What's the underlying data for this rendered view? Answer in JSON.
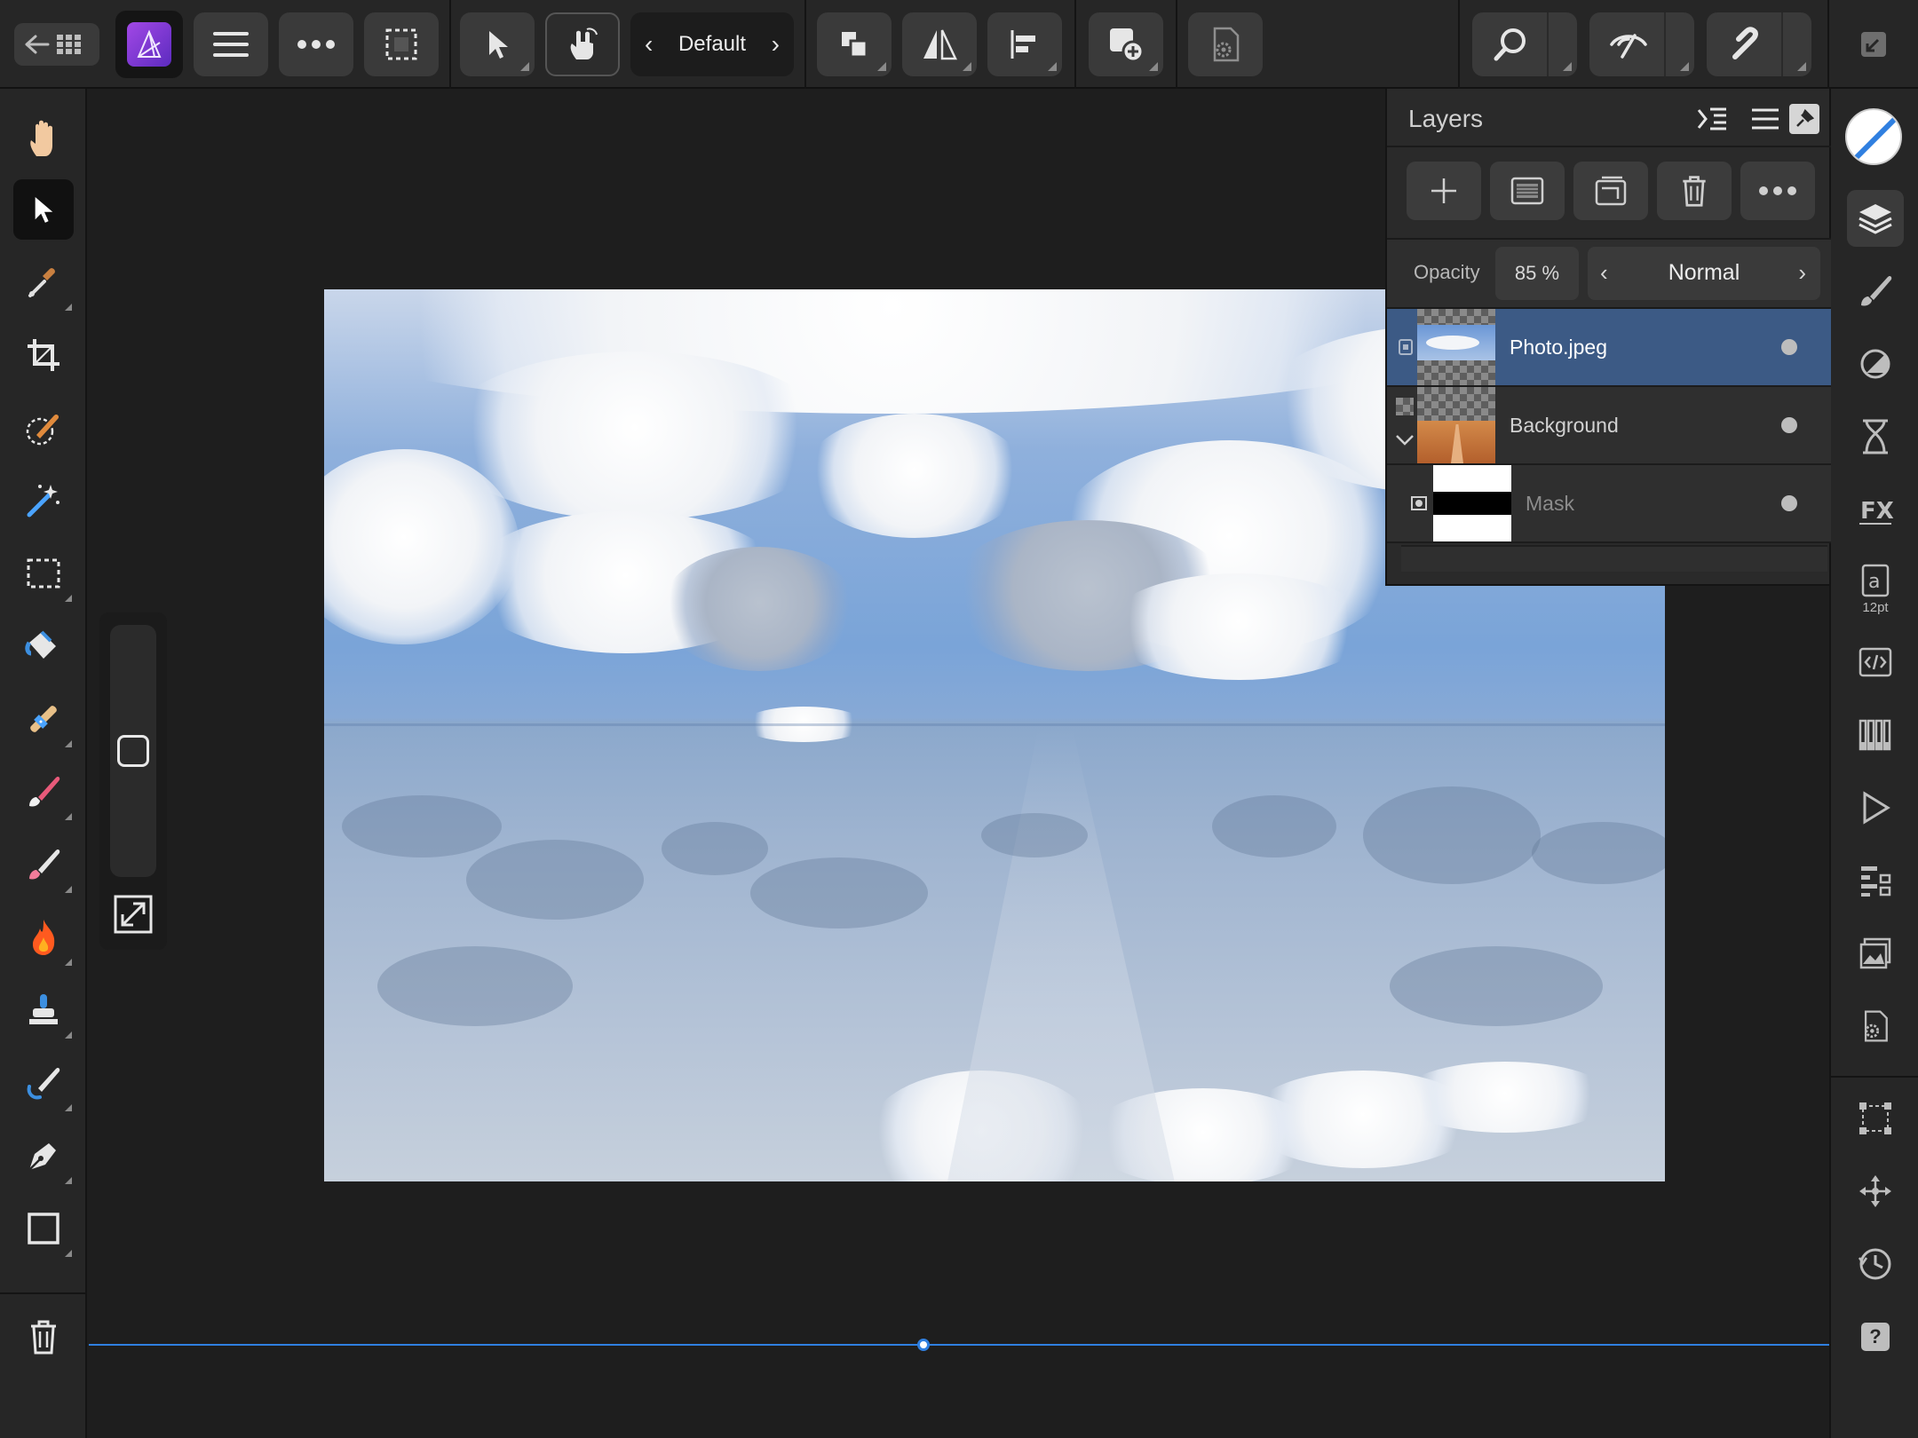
{
  "toolbar": {
    "persona_preset": "Default",
    "colors": {
      "accent_persona": "#7a3fd1",
      "background": "#262626",
      "button": "#3a3a3a"
    }
  },
  "left_tools": [
    {
      "name": "view-tool",
      "icon": "hand-icon"
    },
    {
      "name": "move-tool",
      "icon": "arrow-pointer-icon",
      "active": true
    },
    {
      "name": "color-picker-tool",
      "icon": "eyedropper-icon"
    },
    {
      "name": "crop-tool",
      "icon": "crop-icon"
    },
    {
      "name": "selection-brush-tool",
      "icon": "selection-brush-icon"
    },
    {
      "name": "flood-select-tool",
      "icon": "magic-wand-icon"
    },
    {
      "name": "marquee-tool",
      "icon": "rectangle-marquee-icon"
    },
    {
      "name": "flood-fill-tool",
      "icon": "paint-bucket-icon"
    },
    {
      "name": "inpainting-tool",
      "icon": "bandage-icon"
    },
    {
      "name": "paint-brush-tool",
      "icon": "brush-icon"
    },
    {
      "name": "erase-brush-tool",
      "icon": "eraser-icon"
    },
    {
      "name": "burn-tool",
      "icon": "flame-icon"
    },
    {
      "name": "clone-tool",
      "icon": "stamp-icon"
    },
    {
      "name": "smudge-tool",
      "icon": "smudge-icon"
    },
    {
      "name": "pen-tool",
      "icon": "pen-nib-icon"
    },
    {
      "name": "rectangle-tool",
      "icon": "rectangle-icon"
    }
  ],
  "layers_panel": {
    "title": "Layers",
    "opacity_label": "Opacity",
    "opacity_value": "85 %",
    "blend_mode": "Normal",
    "layers": [
      {
        "name": "Photo.jpeg",
        "selected": true
      },
      {
        "name": "Background",
        "selected": false
      },
      {
        "name": "Mask",
        "selected": false,
        "child": true
      }
    ]
  },
  "studio": {
    "text_size_label": "12pt",
    "help_label": "?"
  },
  "guide": {
    "color": "#2f7fe0"
  }
}
